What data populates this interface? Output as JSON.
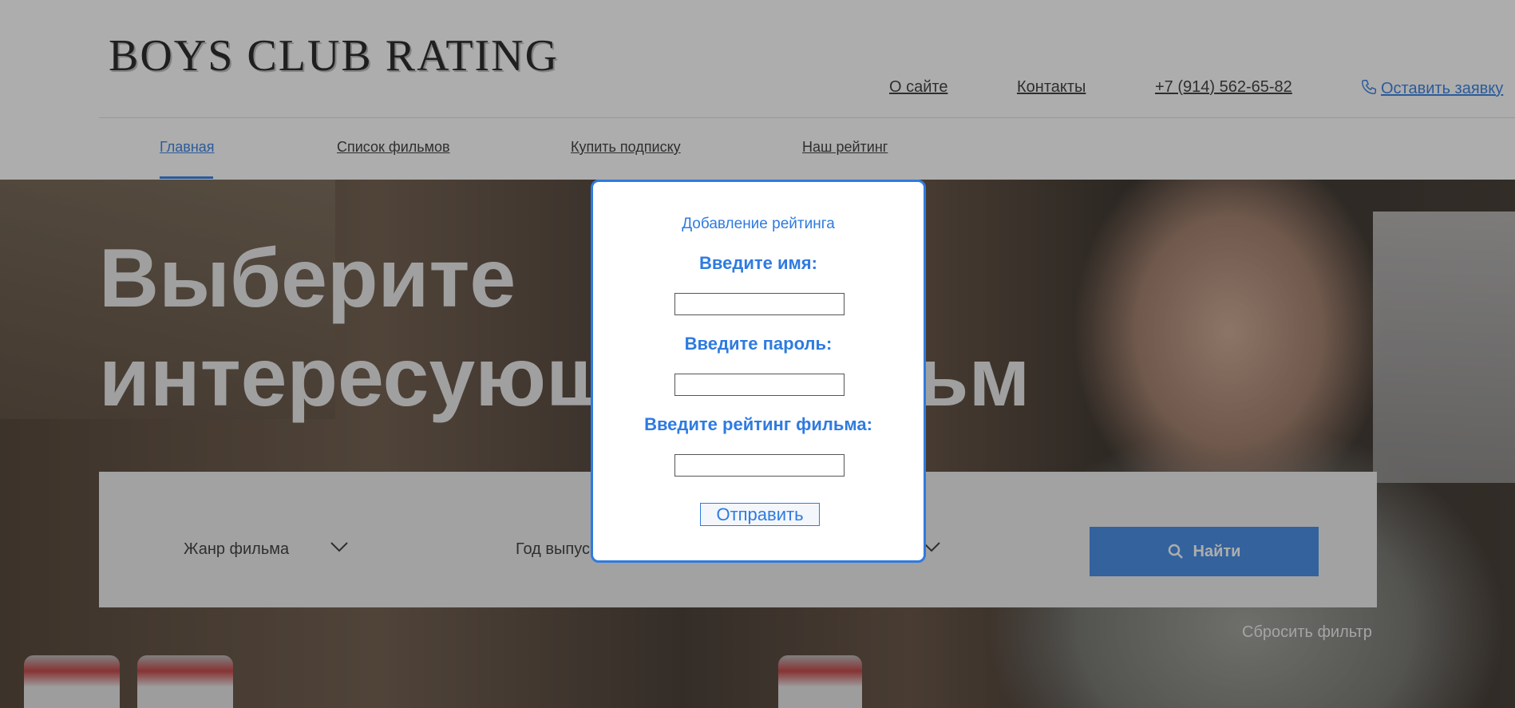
{
  "header": {
    "logo": "BOYS CLUB RATING",
    "top_links": {
      "about": "О сайте",
      "contacts": "Контакты",
      "phone": "+7 (914) 562-65-82",
      "request": "Оставить заявку"
    },
    "nav": {
      "home": "Главная",
      "films": "Список фильмов",
      "subscribe": "Купить подписку",
      "rating": "Наш рейтинг"
    }
  },
  "hero": {
    "headline_line1": "Выберите",
    "headline_line2": "интересующий фильм",
    "filters": {
      "genre": "Жанр фильма",
      "year": "Год выпуска"
    },
    "search_button": "Найти",
    "reset": "Сбросить фильтр"
  },
  "modal": {
    "title": "Добавление рейтинга",
    "name_label": "Введите имя:",
    "name_value": "",
    "password_label": "Введите пароль:",
    "password_value": "",
    "rating_label": "Введите рейтинг фильма:",
    "rating_value": "",
    "submit": "Отправить"
  },
  "colors": {
    "accent": "#2e7be0",
    "overlay": "rgba(40,40,40,0.38)"
  }
}
